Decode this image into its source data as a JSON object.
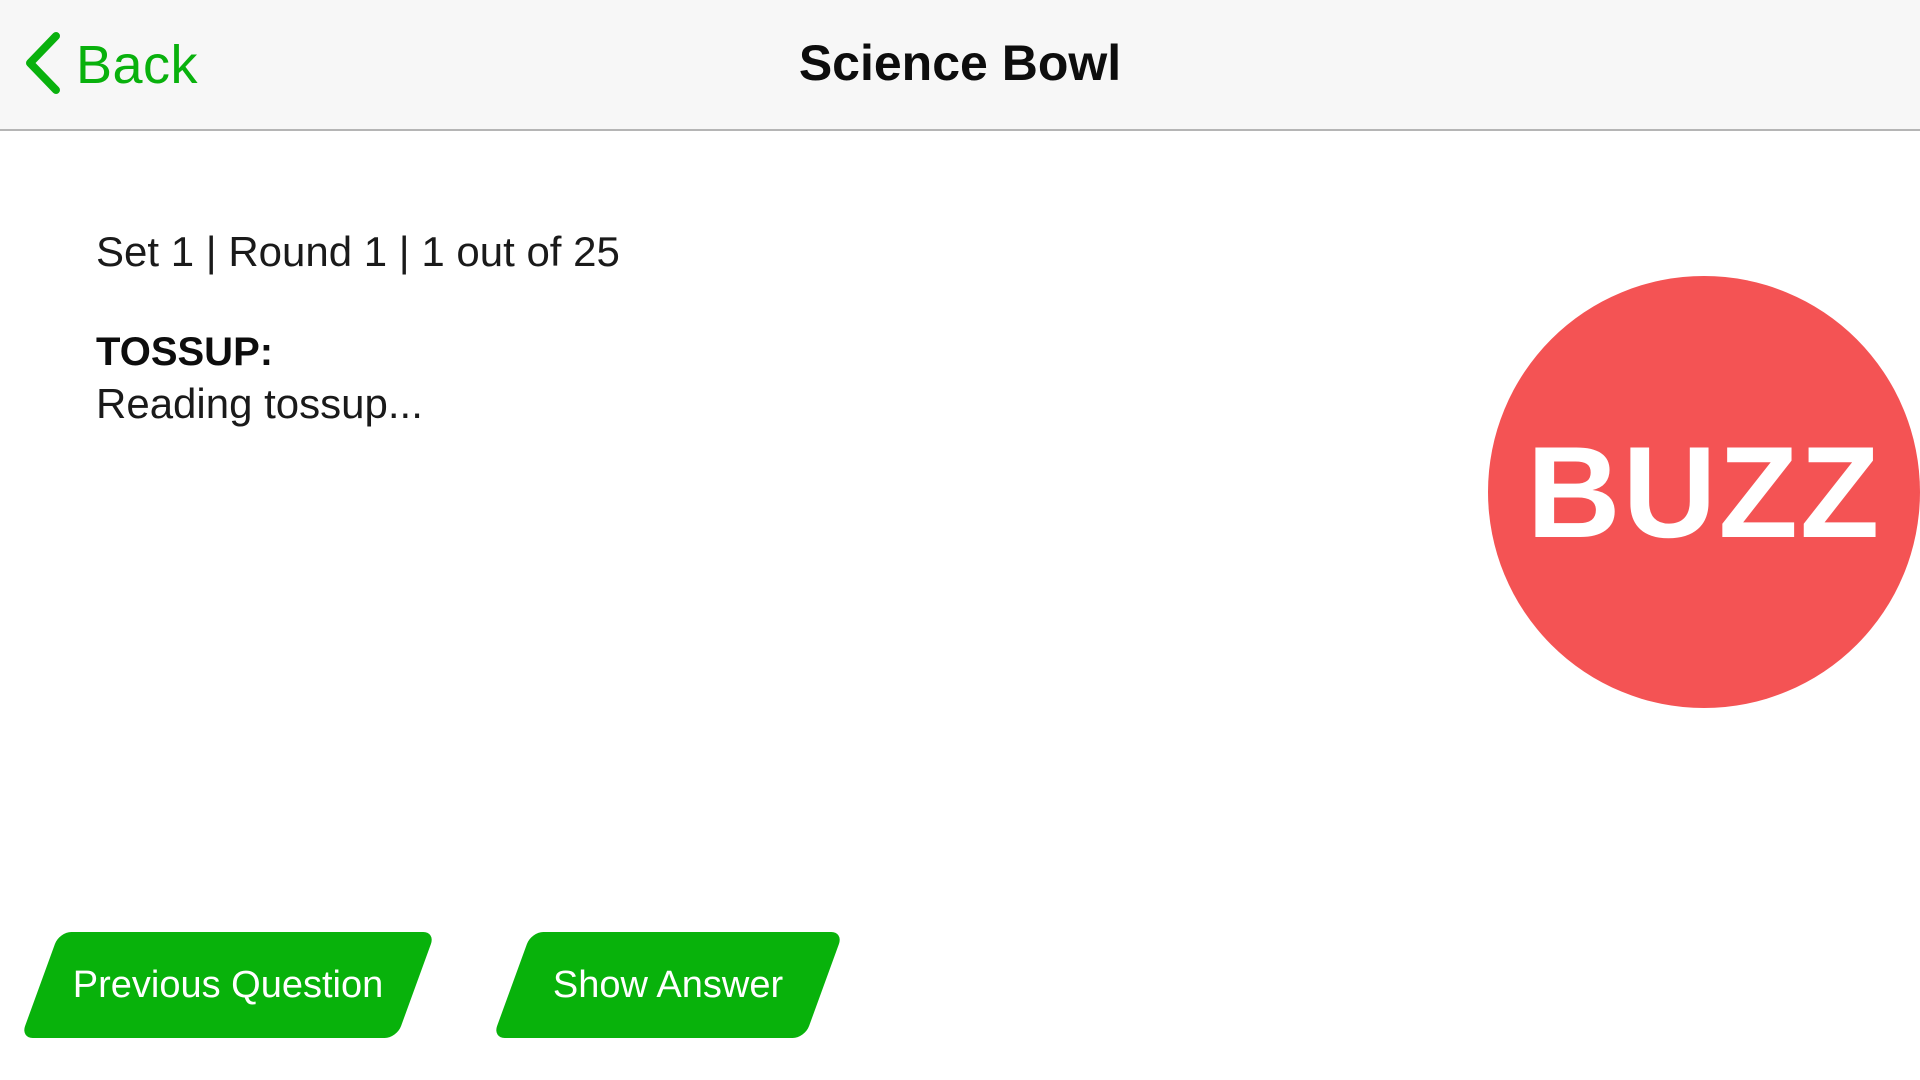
{
  "header": {
    "back_label": "Back",
    "back_icon": "chevron-left-icon",
    "title": "Science Bowl",
    "accent_color": "#09b10d"
  },
  "question": {
    "status": "Set 1 | Round 1 | 1 out of 25",
    "type_label": "TOSSUP:",
    "text": "Reading tossup..."
  },
  "buzz": {
    "label": "BUZZ",
    "color": "#f45354"
  },
  "actions": {
    "previous_label": "Previous Question",
    "show_answer_label": "Show Answer",
    "color": "#08b20b"
  }
}
